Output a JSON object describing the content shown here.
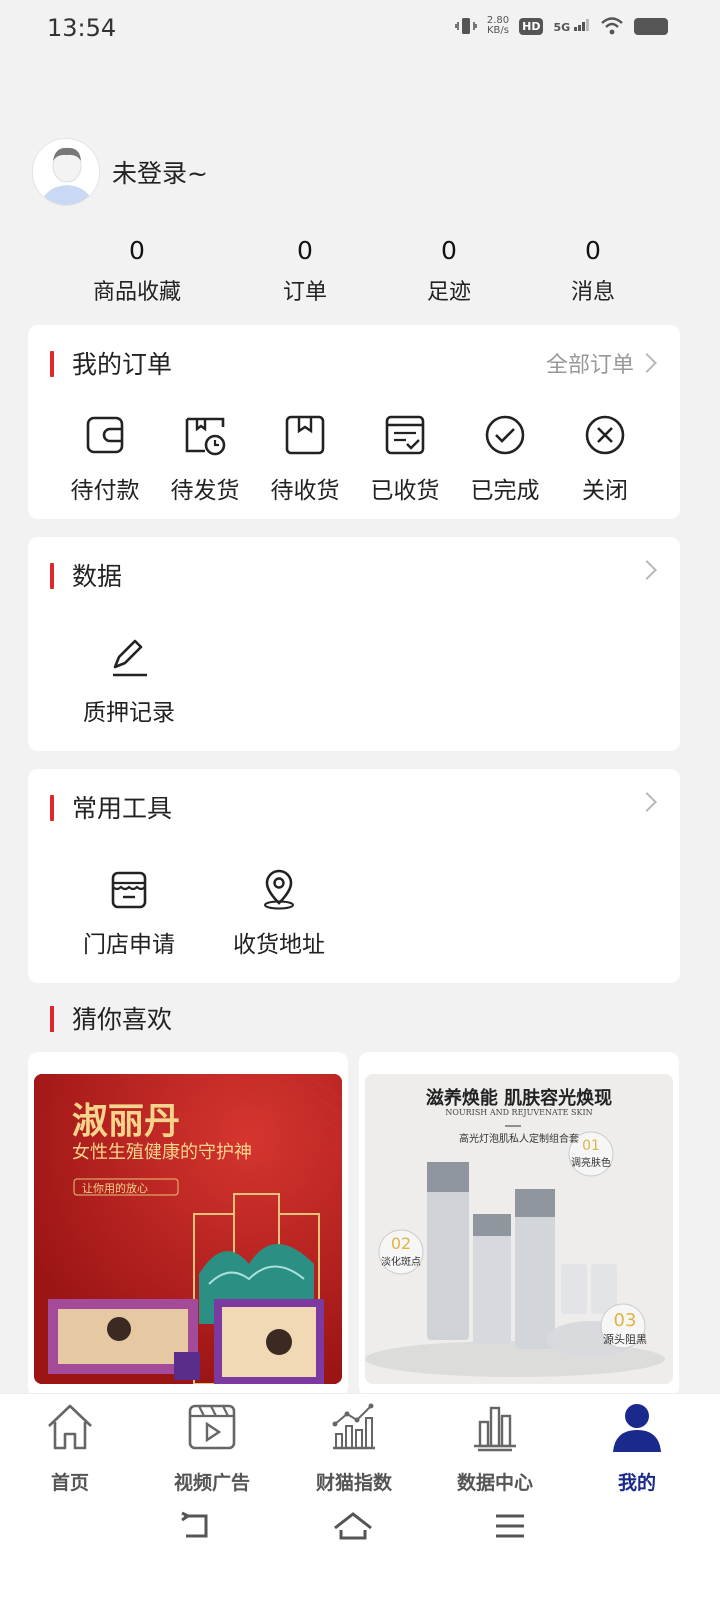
{
  "status": {
    "time": "13:54",
    "speed_value": "2.80",
    "speed_unit": "KB/s",
    "hd": "HD",
    "network": "5G"
  },
  "profile": {
    "login_text": "未登录~"
  },
  "stats": [
    {
      "num": "0",
      "label": "商品收藏"
    },
    {
      "num": "0",
      "label": "订单"
    },
    {
      "num": "0",
      "label": "足迹"
    },
    {
      "num": "0",
      "label": "消息"
    }
  ],
  "orders": {
    "title": "我的订单",
    "more": "全部订单",
    "items": [
      {
        "label": "待付款",
        "icon": "wallet-icon"
      },
      {
        "label": "待发货",
        "icon": "box-clock-icon"
      },
      {
        "label": "待收货",
        "icon": "package-icon"
      },
      {
        "label": "已收货",
        "icon": "receipt-icon"
      },
      {
        "label": "已完成",
        "icon": "check-circle-icon"
      },
      {
        "label": "关闭",
        "icon": "close-circle-icon"
      }
    ]
  },
  "data_card": {
    "title": "数据",
    "items": [
      {
        "label": "质押记录",
        "icon": "pen-icon"
      }
    ]
  },
  "tools": {
    "title": "常用工具",
    "items": [
      {
        "label": "门店申请",
        "icon": "store-icon"
      },
      {
        "label": "收货地址",
        "icon": "location-icon"
      }
    ]
  },
  "recommend": {
    "title": "猜你喜欢"
  },
  "products": [
    {
      "name": "淑丽丹",
      "subtitle": "女性生殖健康的守护神",
      "tag": "让你用的放心"
    },
    {
      "headline": "滋养焕能 肌肤容光焕现",
      "headline_en": "NOURISH AND REJUVENATE SKIN",
      "subline": "高光灯泡肌私人定制组合套",
      "badges": [
        {
          "num": "01",
          "text": "调亮肤色"
        },
        {
          "num": "02",
          "text": "淡化斑点"
        },
        {
          "num": "03",
          "text": "源头阻黑"
        }
      ]
    }
  ],
  "tabbar": [
    {
      "label": "首页",
      "icon": "home-icon"
    },
    {
      "label": "视频广告",
      "icon": "video-icon"
    },
    {
      "label": "财猫指数",
      "icon": "bar-chart-icon"
    },
    {
      "label": "数据中心",
      "icon": "data-center-icon"
    },
    {
      "label": "我的",
      "icon": "profile-icon",
      "active": true
    }
  ],
  "colors": {
    "accent": "#e0282c",
    "active_tab": "#1a2a8c",
    "background": "#f2f2f2"
  }
}
